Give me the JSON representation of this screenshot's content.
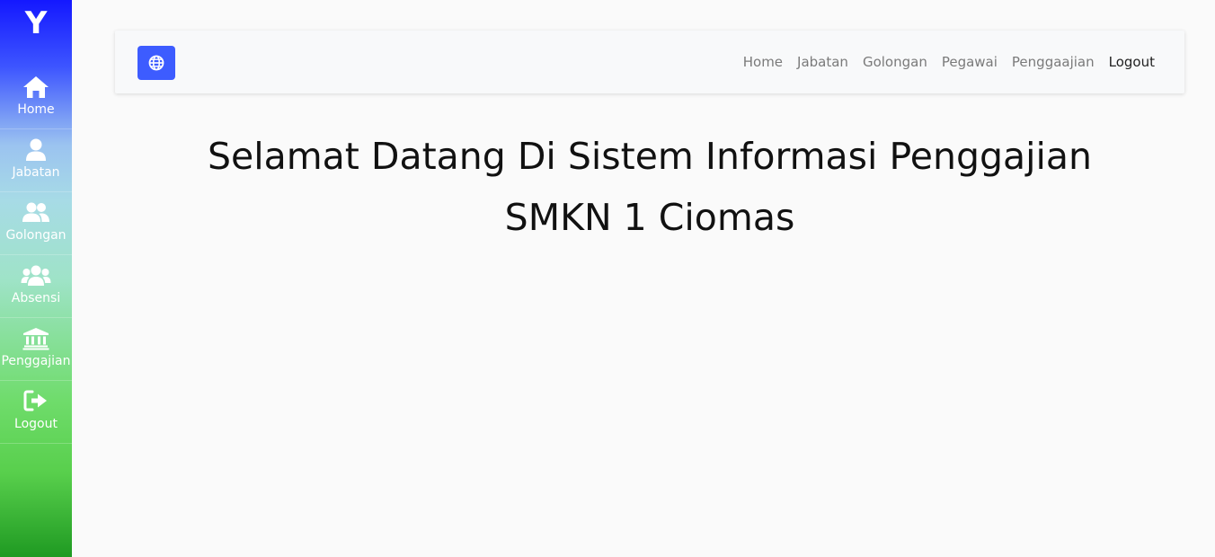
{
  "sidebar": {
    "logo": "Y",
    "items": [
      {
        "label": "Home",
        "icon": "home-icon"
      },
      {
        "label": "Jabatan",
        "icon": "user-icon"
      },
      {
        "label": "Golongan",
        "icon": "users-icon"
      },
      {
        "label": "Absensi",
        "icon": "users-group-icon"
      },
      {
        "label": "Penggajian",
        "icon": "bank-icon"
      },
      {
        "label": "Logout",
        "icon": "logout-icon"
      }
    ]
  },
  "navbar": {
    "toggle_icon": "globe-icon",
    "toggle_color": "#3d5cff",
    "links": [
      {
        "label": "Home"
      },
      {
        "label": "Jabatan"
      },
      {
        "label": "Golongan"
      },
      {
        "label": "Pegawai"
      },
      {
        "label": "Penggaajian"
      },
      {
        "label": "Logout",
        "active": true
      }
    ]
  },
  "main": {
    "title_line1": "Selamat Datang Di Sistem Informasi Penggajian",
    "title_line2": "SMKN 1 Ciomas"
  }
}
